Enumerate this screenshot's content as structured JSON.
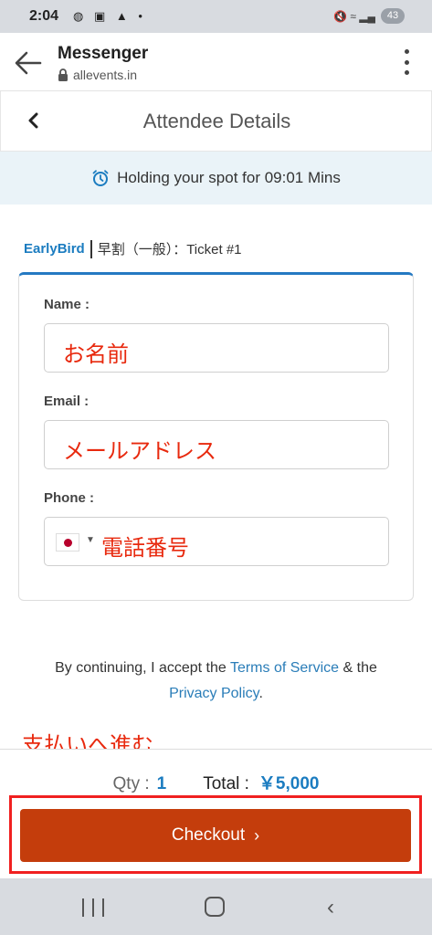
{
  "status_bar": {
    "time": "2:04",
    "left_icons": "◍ ▣ ▲ •",
    "right_icons": "🔇 ≈ ▂▄",
    "battery": "43"
  },
  "browser": {
    "title": "Messenger",
    "url": "allevents.in"
  },
  "page": {
    "title": "Attendee Details"
  },
  "timer": {
    "text": "Holding your spot for 09:01 Mins"
  },
  "ticket": {
    "name": "EarlyBird",
    "desc": "早割（一般）：Ticket #1"
  },
  "form": {
    "name_label": "Name :",
    "name_value": "お名前",
    "email_label": "Email :",
    "email_value": "メールアドレス",
    "phone_label": "Phone :",
    "phone_value": "電話番号"
  },
  "terms": {
    "prefix": "By continuing, I accept the ",
    "tos": "Terms of Service",
    "mid": " & the",
    "privacy": "Privacy Policy",
    "suffix": "."
  },
  "annotation": "支払いへ進む",
  "summary": {
    "qty_label": "Qty :",
    "qty_value": "1",
    "total_label": "Total :",
    "total_value": "￥5,000"
  },
  "checkout": {
    "label": "Checkout",
    "chevron": "›"
  },
  "colors": {
    "accent": "#1b7cc0",
    "annotation": "#e8290e",
    "checkout": "#c43d0c",
    "highlight": "#f02020"
  }
}
